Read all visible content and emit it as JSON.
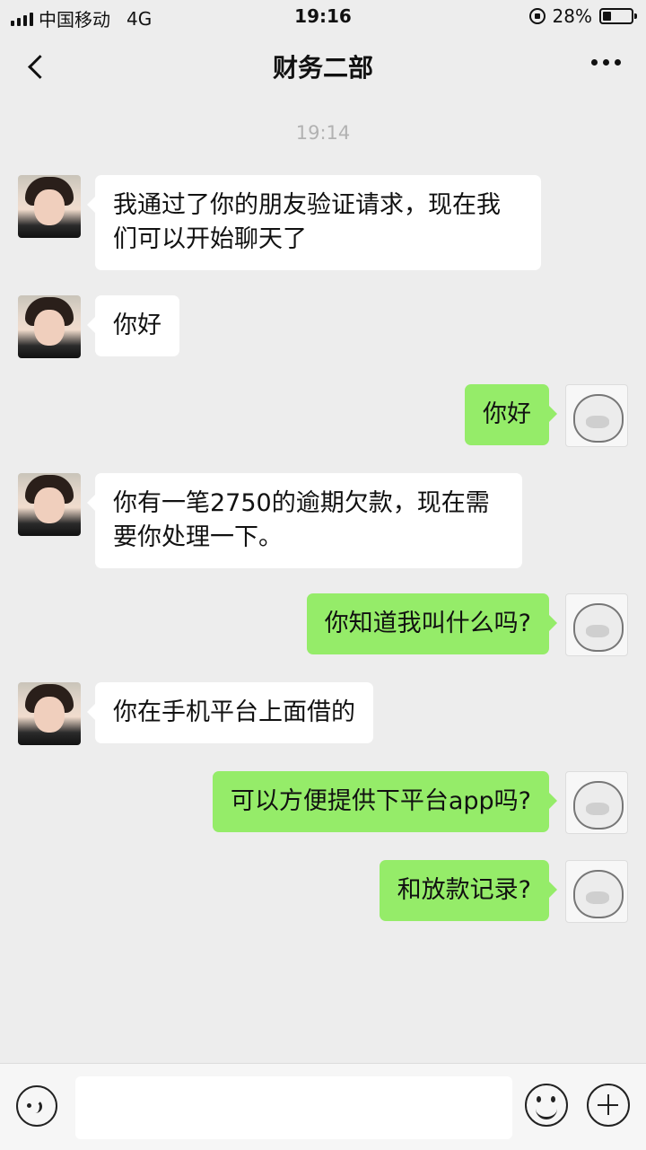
{
  "status_bar": {
    "carrier": "中国移动",
    "network": "4G",
    "time": "19:16",
    "battery": "28%"
  },
  "nav": {
    "title": "财务二部"
  },
  "chat": {
    "timestamp": "19:14",
    "messages": [
      {
        "side": "left",
        "text": "我通过了你的朋友验证请求，现在我们可以开始聊天了"
      },
      {
        "side": "left",
        "text": "你好"
      },
      {
        "side": "right",
        "text": "你好"
      },
      {
        "side": "left",
        "text": "你有一笔2750的逾期欠款，现在需要你处理一下。"
      },
      {
        "side": "right",
        "text": "你知道我叫什么吗?"
      },
      {
        "side": "left",
        "text": "你在手机平台上面借的"
      },
      {
        "side": "right",
        "text": "可以方便提供下平台app吗?"
      },
      {
        "side": "right",
        "text": "和放款记录?"
      }
    ]
  },
  "colors": {
    "background": "#ededed",
    "sent_bubble": "#95ec69",
    "received_bubble": "#ffffff"
  }
}
